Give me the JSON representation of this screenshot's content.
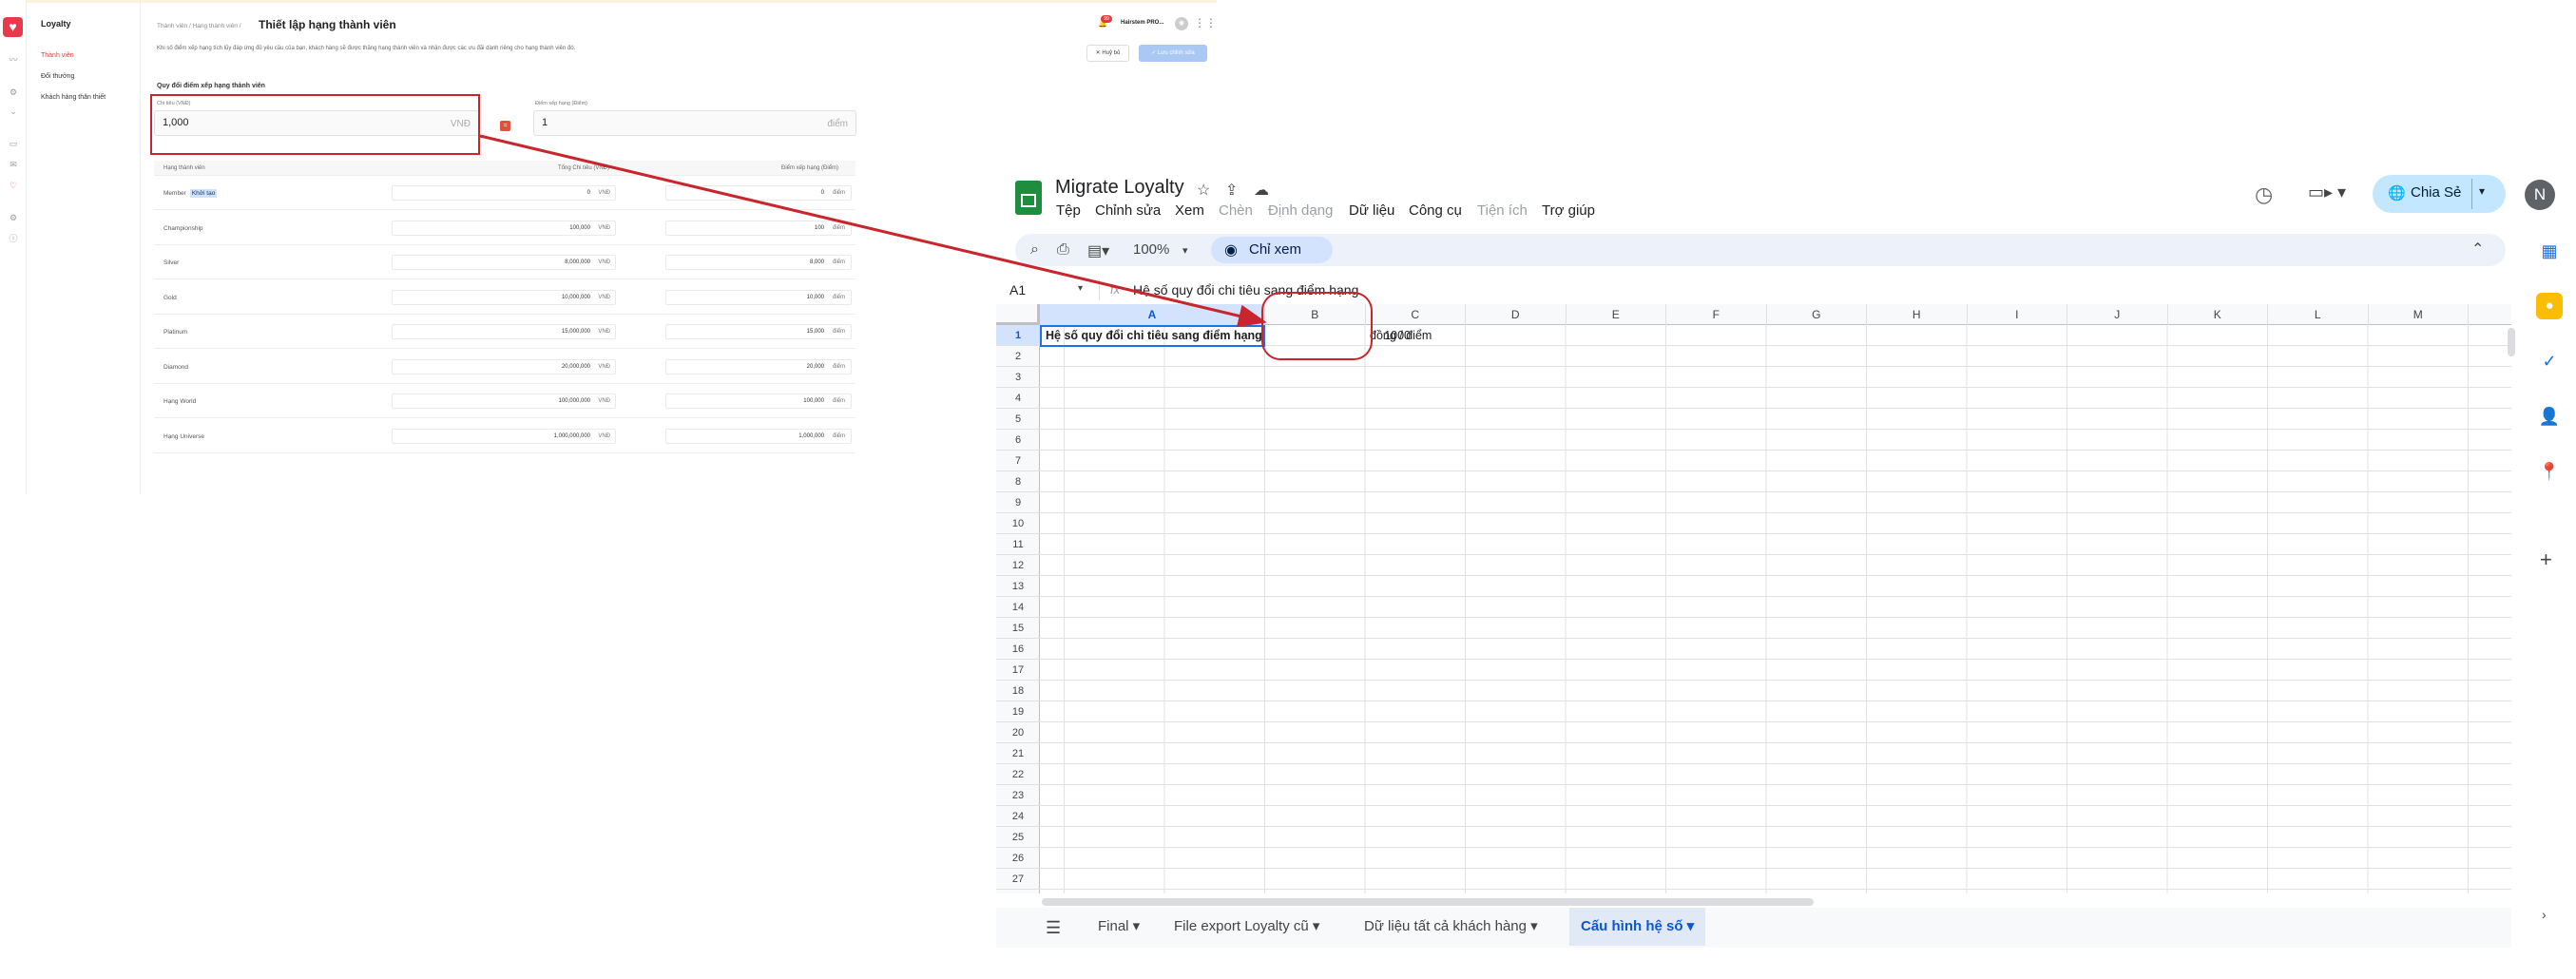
{
  "loyalty": {
    "app_name": "Loyalty",
    "nav": [
      "Thành viên",
      "Đổi thưởng",
      "Khách hàng thân thiết"
    ],
    "breadcrumb": "Thành viên  /  Hạng thành viên  /",
    "page_title": "Thiết lập hạng thành viên",
    "description": "Khi số điểm xếp hạng tích lũy đáp ứng đủ yêu cầu của bạn, khách hàng sẽ được thăng hạng thành viên và nhận được các ưu đãi dành riêng cho hạng thành viên đó.",
    "section_title": "Quy đổi điểm xếp hạng thành viên",
    "spend_label": "Chi tiêu (VNĐ)",
    "spend_value": "1,000",
    "spend_unit": "VNĐ",
    "points_label": "Điểm xếp hạng (Điểm)",
    "points_value": "1",
    "points_unit": "điểm",
    "table_headers": {
      "tier": "Hạng thành viên",
      "spend": "Tổng Chi tiêu (VNĐ)",
      "points": "Điểm xếp hạng (Điểm)"
    },
    "tiers": [
      {
        "name": "Member",
        "tag": "Khởi tạo",
        "spend": "0",
        "points": "0"
      },
      {
        "name": "Championship",
        "tag": "",
        "spend": "100,000",
        "points": "100"
      },
      {
        "name": "Silver",
        "tag": "",
        "spend": "8,000,000",
        "points": "8,000"
      },
      {
        "name": "Gold",
        "tag": "",
        "spend": "10,000,000",
        "points": "10,000"
      },
      {
        "name": "Platinum",
        "tag": "",
        "spend": "15,000,000",
        "points": "15,000"
      },
      {
        "name": "Diamond",
        "tag": "",
        "spend": "20,000,000",
        "points": "20,000"
      },
      {
        "name": "Hạng World",
        "tag": "",
        "spend": "100,000,000",
        "points": "100,000"
      },
      {
        "name": "Hạng Universe",
        "tag": "",
        "spend": "1,000,000,000",
        "points": "1,000,000"
      }
    ],
    "vnd_unit": "VNĐ",
    "diem_unit": "điểm",
    "notification_count": "99",
    "user_name": "Hairstem PRO...",
    "cancel_label": "✕ Huỷ bỏ",
    "save_label": "✓ Lưu chỉnh sửa"
  },
  "sheets": {
    "title": "Migrate Loyalty",
    "menus": [
      "Tệp",
      "Chỉnh sửa",
      "Xem",
      "Chèn",
      "Định dạng",
      "Dữ liệu",
      "Công cụ",
      "Tiện ích",
      "Trợ giúp"
    ],
    "disabled_menus": [
      "Chèn",
      "Định dạng",
      "Tiện ích"
    ],
    "share_label": "Chia Sẻ",
    "account_initial": "N",
    "zoom": "100%",
    "view_mode": "Chỉ xem",
    "name_box": "A1",
    "fx": "fx",
    "formula_value": "Hệ số quy đổi chi tiêu sang điểm hạng",
    "columns": [
      "A",
      "B",
      "C",
      "D",
      "E",
      "F",
      "G",
      "H",
      "I",
      "J",
      "K",
      "L",
      "M"
    ],
    "rows": [
      "1",
      "2",
      "3",
      "4",
      "5",
      "6",
      "7",
      "8",
      "9",
      "10",
      "11",
      "12",
      "13",
      "14",
      "15",
      "16",
      "17",
      "18",
      "19",
      "20",
      "21",
      "22",
      "23",
      "24",
      "25",
      "26",
      "27"
    ],
    "cells": {
      "A1": "Hệ số quy đổi chi tiêu sang điểm hạng",
      "B1": "1000",
      "C1": "đồng / điểm"
    },
    "sheet_tabs": [
      "Final",
      "File export Loyalty cũ",
      "Dữ liệu tất cả khách hàng",
      "Cấu hình hệ số"
    ],
    "active_tab": "Cấu hình hệ số",
    "colors": {
      "accent": "#0b57d0",
      "annotation": "#c9252c",
      "brand": "#1e8e3e"
    }
  }
}
